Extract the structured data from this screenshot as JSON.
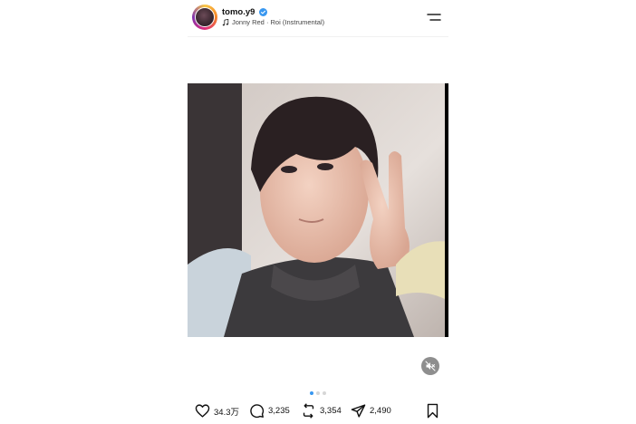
{
  "header": {
    "username": "tomo.y9",
    "music": "Jonny Red · Roi (Instrumental)",
    "avatar_icon": "profile-avatar",
    "verified_icon": "verified-badge-icon",
    "menu_icon": "hamburger-menu-icon"
  },
  "media": {
    "image_alt": "Young person making a peace sign",
    "mute_icon": "speaker-muted-icon",
    "carousel": {
      "total": 3,
      "active": 1
    }
  },
  "actions": {
    "likes": "34.3万",
    "comments": "3,235",
    "reposts": "3,354",
    "shares": "2,490",
    "icons": [
      "heart-icon",
      "comment-icon",
      "repost-icon",
      "share-icon",
      "bookmark-icon"
    ]
  },
  "colors": {
    "accent": "#3897f0",
    "verified": "#3897f0",
    "text": "#111111"
  }
}
